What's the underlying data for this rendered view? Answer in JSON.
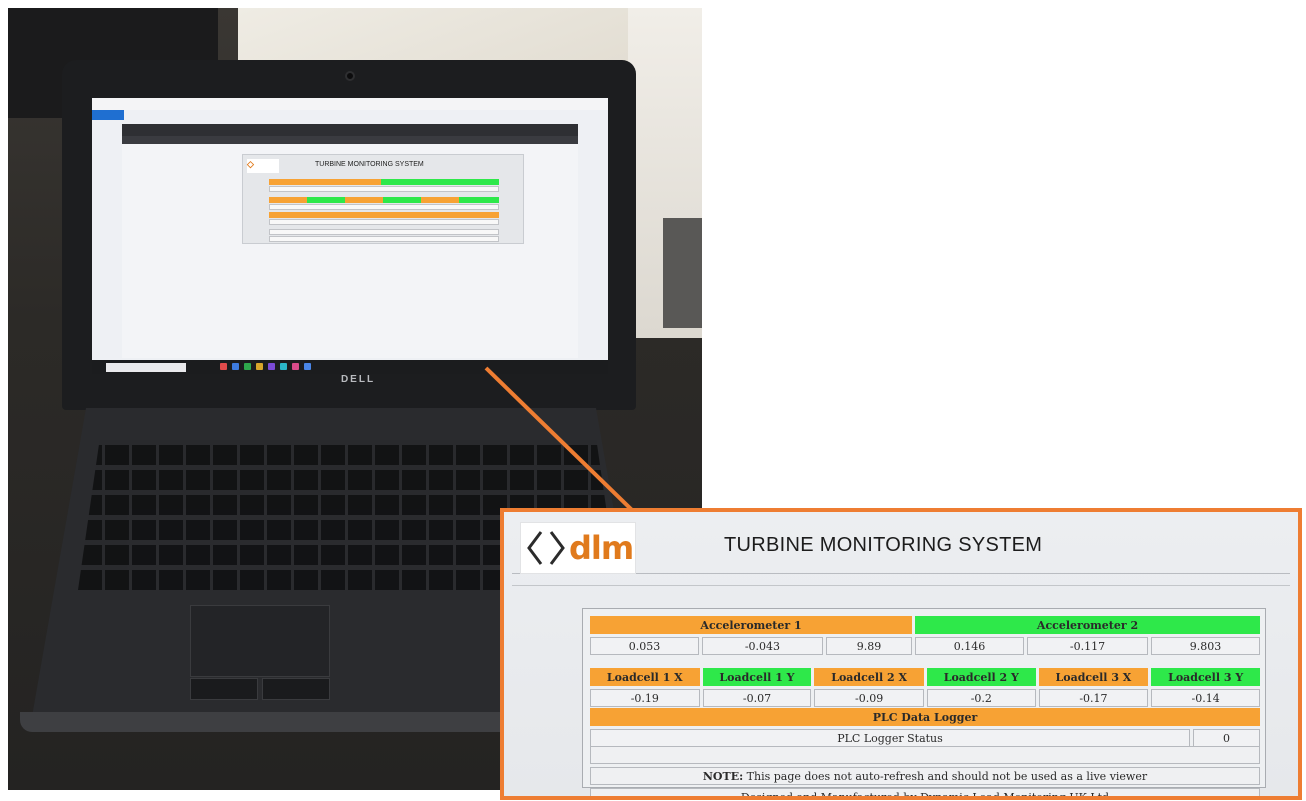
{
  "laptop": {
    "brand": "DELL"
  },
  "zoom": {
    "logo_text": "dlm",
    "title": "TURBINE MONITORING SYSTEM",
    "accelerometers": [
      {
        "label": "Accelerometer 1",
        "color": "#f7a234",
        "values": [
          "0.053",
          "-0.043",
          "9.89"
        ]
      },
      {
        "label": "Accelerometer 2",
        "color": "#2ee84a",
        "values": [
          "0.146",
          "-0.117",
          "9.803"
        ]
      }
    ],
    "loadcells": [
      {
        "label": "Loadcell 1 X",
        "color": "#f7a234",
        "value": "-0.19"
      },
      {
        "label": "Loadcell 1 Y",
        "color": "#2ee84a",
        "value": "-0.07"
      },
      {
        "label": "Loadcell 2 X",
        "color": "#f7a234",
        "value": "-0.09"
      },
      {
        "label": "Loadcell 2 Y",
        "color": "#2ee84a",
        "value": "-0.2"
      },
      {
        "label": "Loadcell 3 X",
        "color": "#f7a234",
        "value": "-0.17"
      },
      {
        "label": "Loadcell 3 Y",
        "color": "#2ee84a",
        "value": "-0.14"
      }
    ],
    "plc": {
      "header": "PLC Data Logger",
      "status_label": "PLC Logger Status",
      "status_value": "0"
    },
    "note": {
      "prefix": "NOTE:",
      "text": " This page does not auto-refresh and should not be used as a live viewer"
    },
    "footer": "Designed and Manufactured by Dynamic Load Monitoring UK Ltd"
  },
  "colors": {
    "callout": "#ee7d32",
    "orange": "#f7a234",
    "green": "#2ee84a"
  }
}
